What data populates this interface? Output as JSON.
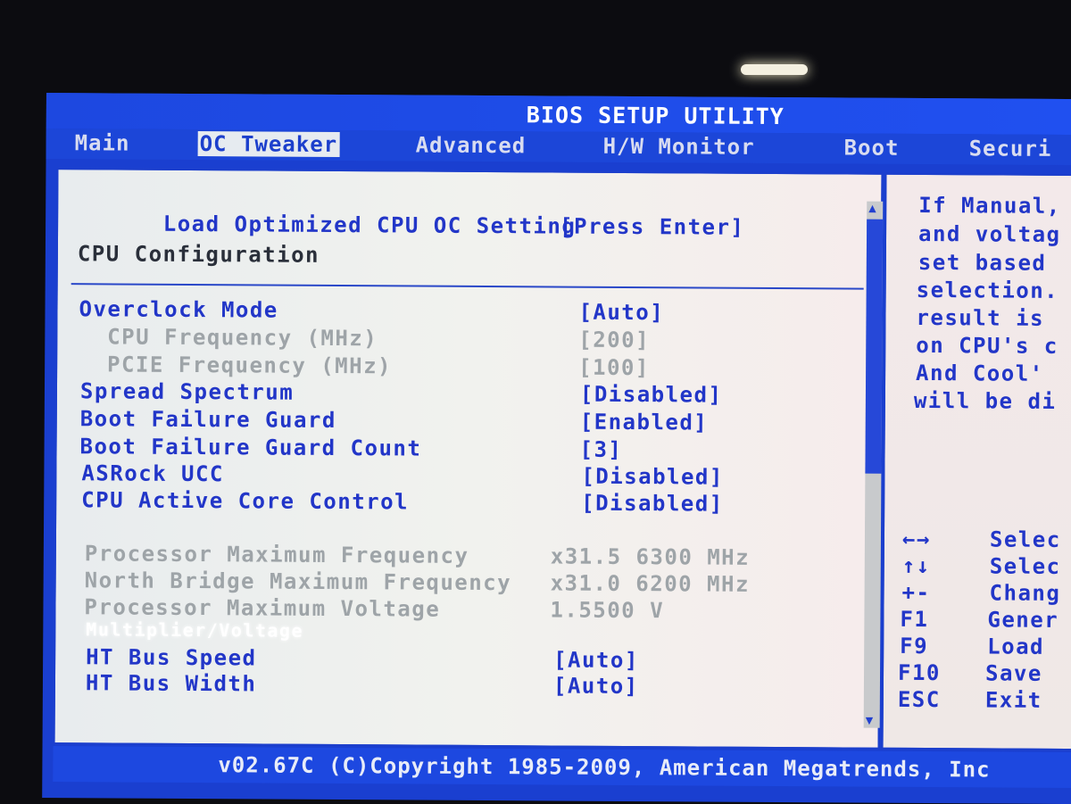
{
  "title": "BIOS SETUP UTILITY",
  "tabs": [
    {
      "label": "Main",
      "active": false
    },
    {
      "label": "OC Tweaker",
      "active": true
    },
    {
      "label": "Advanced",
      "active": false
    },
    {
      "label": "H/W Monitor",
      "active": false
    },
    {
      "label": "Boot",
      "active": false
    },
    {
      "label": "Securi",
      "active": false
    }
  ],
  "main": {
    "load_optimized": {
      "label": "Load Optimized CPU OC Setting",
      "value": "[Press Enter]"
    },
    "section_header": "CPU Configuration",
    "settings": [
      {
        "label": "Overclock Mode",
        "value": "[Auto]",
        "state": "enabled"
      },
      {
        "label": "  CPU Frequency (MHz)",
        "value": "[200]",
        "state": "disabled"
      },
      {
        "label": "  PCIE Frequency (MHz)",
        "value": "[100]",
        "state": "disabled"
      },
      {
        "label": "Spread Spectrum",
        "value": "[Disabled]",
        "state": "enabled"
      },
      {
        "label": "Boot Failure Guard",
        "value": "[Enabled]",
        "state": "enabled"
      },
      {
        "label": "Boot Failure Guard Count",
        "value": "[3]",
        "state": "enabled"
      },
      {
        "label": "ASRock UCC",
        "value": "[Disabled]",
        "state": "enabled"
      },
      {
        "label": "CPU Active Core Control",
        "value": "[Disabled]",
        "state": "enabled"
      }
    ],
    "info": [
      {
        "label": "Processor Maximum Frequency",
        "value": "x31.5 6300 MHz"
      },
      {
        "label": "North Bridge Maximum Frequency",
        "value": "x31.0 6200 MHz"
      },
      {
        "label": "Processor Maximum Voltage",
        "value": "1.5500 V"
      }
    ],
    "selected_item": "Multiplier/Voltage",
    "ht_settings": [
      {
        "label": "HT Bus Speed",
        "value": "[Auto]"
      },
      {
        "label": "HT Bus Width",
        "value": "[Auto]"
      }
    ]
  },
  "help": {
    "lines": [
      "If Manual,",
      "and voltag",
      "set based",
      "selection.",
      "result is",
      "on CPU's c",
      "And Cool'",
      "will be di"
    ],
    "keys": [
      {
        "key": "←→",
        "desc": "Selec"
      },
      {
        "key": "↑↓",
        "desc": "Selec"
      },
      {
        "key": "+-",
        "desc": "Chang"
      },
      {
        "key": "F1",
        "desc": "Gener"
      },
      {
        "key": "F9",
        "desc": "Load"
      },
      {
        "key": "F10",
        "desc": "Save"
      },
      {
        "key": "ESC",
        "desc": "Exit"
      }
    ]
  },
  "footer": "v02.67C (C)Copyright 1985-2009, American Megatrends, Inc",
  "colors": {
    "bios_blue": "#1d48e0",
    "text_blue": "#2236c8",
    "disabled_gray": "#9ea4a8",
    "panel_bg": "#eef0ee"
  }
}
